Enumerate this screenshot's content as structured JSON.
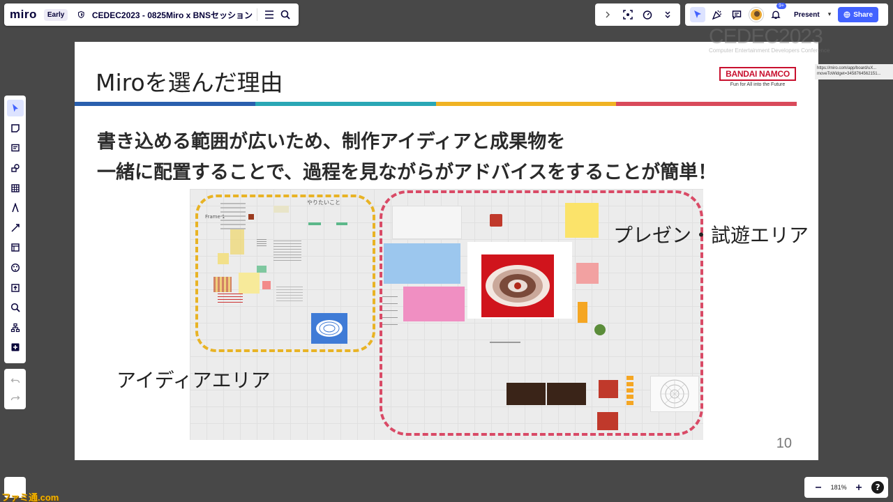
{
  "app": {
    "logo": "miro",
    "plan_badge": "Early",
    "board_title": "CEDEC2023 - 0825Miro x BNSセッション"
  },
  "toolbar": {
    "present_label": "Present",
    "share_label": "Share",
    "notification_count": "9+"
  },
  "slide": {
    "title": "Miroを選んだ理由",
    "body_line1": "書き込める範囲が広いため、制作アイディアと成果物を",
    "body_line2": "一緒に配置することで、過程を見ながらがアドバイスをすることが簡単！",
    "idea_area_label": "アイディアエリア",
    "play_area_label": "プレゼン・試遊エリア",
    "board_text_yaritaikoto": "やりたいこと",
    "board_text_frame": "Frame 1",
    "page_number": "10",
    "logo": {
      "brand": "BANDAI NAMCO",
      "tagline": "Fun for All into the Future"
    },
    "color_bar": [
      "#2a5fae",
      "#2aa7b5",
      "#f0b323",
      "#d94a5a"
    ]
  },
  "overlay": {
    "cedec_main": "CEDEC2023",
    "cedec_sub": "Computer Entertainment Developers Conference",
    "tooltip": "https://miro.com/app/board/uX... moveToWidget=3458764562151..."
  },
  "zoom": {
    "level": "181%"
  },
  "watermark": "ファミ通.com",
  "colors": {
    "accent": "#4262ff",
    "canvas": "#484848"
  }
}
